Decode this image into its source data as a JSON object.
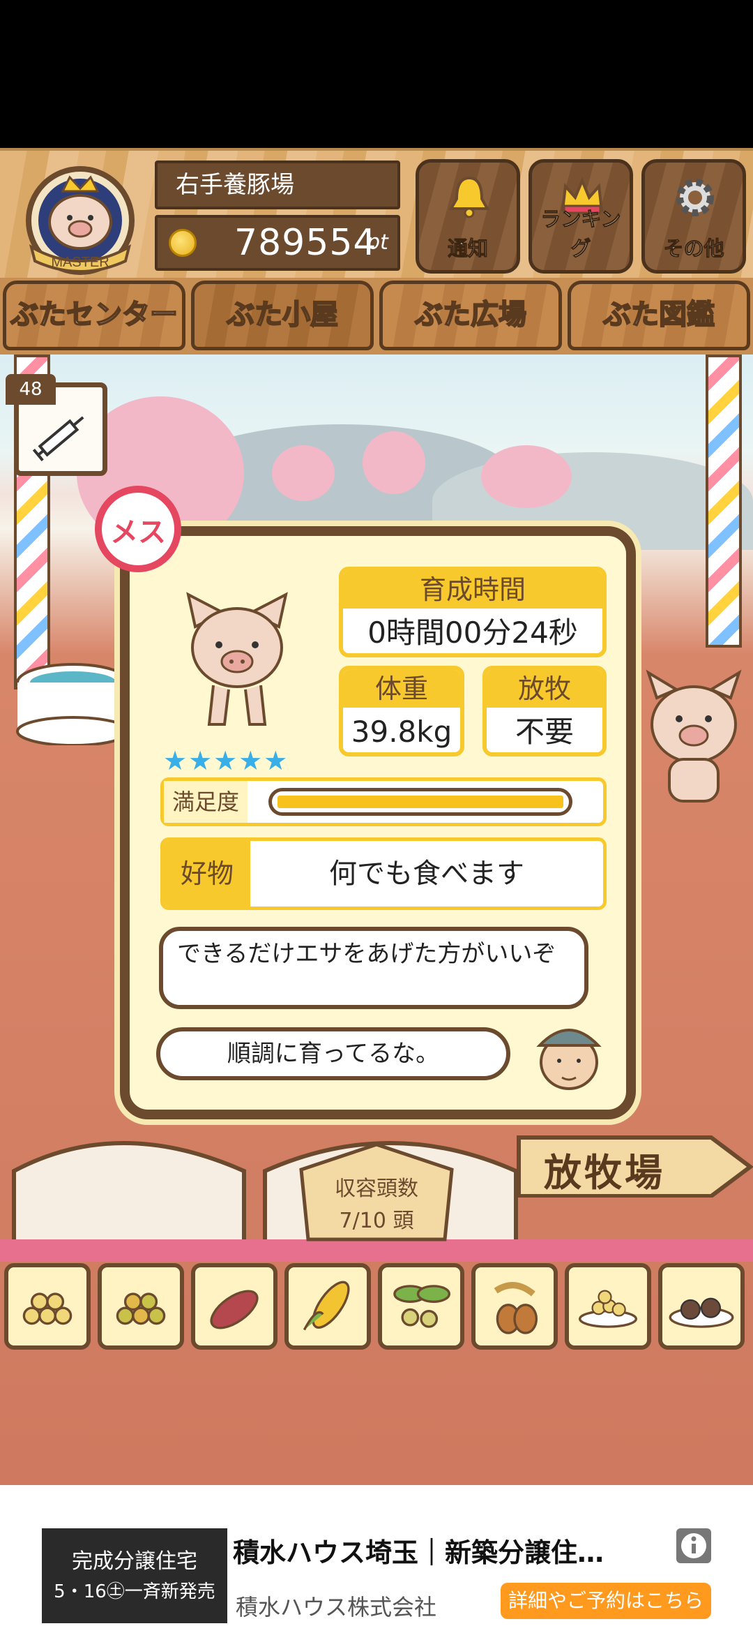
{
  "header": {
    "badge_text": "MASTER",
    "farm_name": "右手養豚場",
    "points_value": "789554",
    "points_unit": "pt",
    "buttons": [
      {
        "label": "通知",
        "icon": "bell-icon"
      },
      {
        "label": "ランキング",
        "icon": "crown-icon"
      },
      {
        "label": "その他",
        "icon": "gear-icon"
      }
    ]
  },
  "tabs": [
    {
      "label": "ぶたセンター"
    },
    {
      "label": "ぶた小屋",
      "active": true
    },
    {
      "label": "ぶた広場"
    },
    {
      "label": "ぶた図鑑"
    }
  ],
  "syringe": {
    "count": "48",
    "icon": "syringe-icon"
  },
  "pig": {
    "gender": "メス",
    "stars": "★★★★★",
    "star_count": 5,
    "time_label": "育成時間",
    "time_value": "0時間00分24秒",
    "weight_label": "体重",
    "weight_value": "39.8kg",
    "grazing_label": "放牧",
    "grazing_value": "不要",
    "satisfaction_label": "満足度",
    "satisfaction_level": 1.0,
    "favorite_label": "好物",
    "favorite_value": "何でも食べます",
    "advice": "できるだけエサをあげた方がいいぞ",
    "comment": "順調に育ってるな。"
  },
  "capacity": {
    "label": "収容頭数",
    "value": "7/10 頭"
  },
  "pasture": {
    "label": "放牧場"
  },
  "foods": [
    {
      "icon": "soybean-pile-icon"
    },
    {
      "icon": "mixed-beans-icon"
    },
    {
      "icon": "sweet-potato-icon"
    },
    {
      "icon": "corn-icon"
    },
    {
      "icon": "leafy-beans-icon"
    },
    {
      "icon": "acorn-icon"
    },
    {
      "icon": "grain-bowl-icon"
    },
    {
      "icon": "meatball-plate-icon"
    }
  ],
  "ad": {
    "thumb_line1": "完成分譲住宅",
    "thumb_line2": "5・16㊏一斉新発売",
    "title": "積水ハウス埼玉｜新築分譲住…",
    "company": "積水ハウス株式会社",
    "cta": "詳細やご予約はこちら"
  },
  "colors": {
    "accent_yellow": "#f8c92c",
    "wood_dark": "#6b4a2e",
    "star_blue": "#3aaee6",
    "female_red": "#e64760",
    "cta_orange": "#ff9a1f"
  }
}
